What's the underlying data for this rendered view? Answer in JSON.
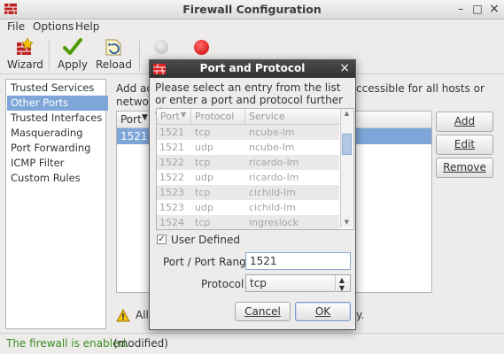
{
  "window": {
    "title": "Firewall Configuration",
    "minimize": "–",
    "maximize": "□",
    "close": "×"
  },
  "menu": [
    {
      "label": "File"
    },
    {
      "label": "Options"
    },
    {
      "label": "Help"
    }
  ],
  "toolbar": {
    "wizard": "Wizard",
    "apply": "Apply",
    "reload": "Reload"
  },
  "sidebar": {
    "items": [
      {
        "label": "Trusted Services"
      },
      {
        "label": "Other Ports"
      },
      {
        "label": "Trusted Interfaces"
      },
      {
        "label": "Masquerading"
      },
      {
        "label": "Port Forwarding"
      },
      {
        "label": "ICMP Filter"
      },
      {
        "label": "Custom Rules"
      }
    ],
    "selected_index": 1
  },
  "main": {
    "desc_line1": "Add add",
    "desc_line1_tail": "ccessible for all hosts or",
    "desc_line2": "network",
    "table_header": "Port",
    "table_row": "1521",
    "buttons": {
      "add": "Add",
      "edit": "Edit",
      "remove": "Remove"
    },
    "warning": "Allo",
    "warning_tail": "y."
  },
  "status": {
    "enabled": "The firewall is enabled.",
    "modified": "(modified)"
  },
  "dialog": {
    "title": "Port and Protocol",
    "close": "×",
    "message": "Please select an entry from the list or enter a port and protocol further down.",
    "columns": {
      "port": "Port",
      "protocol": "Protocol",
      "service": "Service"
    },
    "rows": [
      {
        "port": "1521",
        "protocol": "tcp",
        "service": "ncube-lm"
      },
      {
        "port": "1521",
        "protocol": "udp",
        "service": "ncube-lm"
      },
      {
        "port": "1522",
        "protocol": "tcp",
        "service": "ricardo-lm"
      },
      {
        "port": "1522",
        "protocol": "udp",
        "service": "ricardo-lm"
      },
      {
        "port": "1523",
        "protocol": "tcp",
        "service": "cichild-lm"
      },
      {
        "port": "1523",
        "protocol": "udp",
        "service": "cichild-lm"
      },
      {
        "port": "1524",
        "protocol": "tcp",
        "service": "ingreslock"
      }
    ],
    "user_defined_label": "User Defined",
    "user_defined_checked": true,
    "port_range_label": "Port / Port Range:",
    "port_range_value": "1521",
    "protocol_label": "Protocol:",
    "protocol_value": "tcp",
    "cancel": "Cancel",
    "ok": "OK"
  },
  "colors": {
    "selection": "#7ea6d9",
    "status_green": "#3a8c1e",
    "dialog_title_bg": "#3a3a3a"
  }
}
